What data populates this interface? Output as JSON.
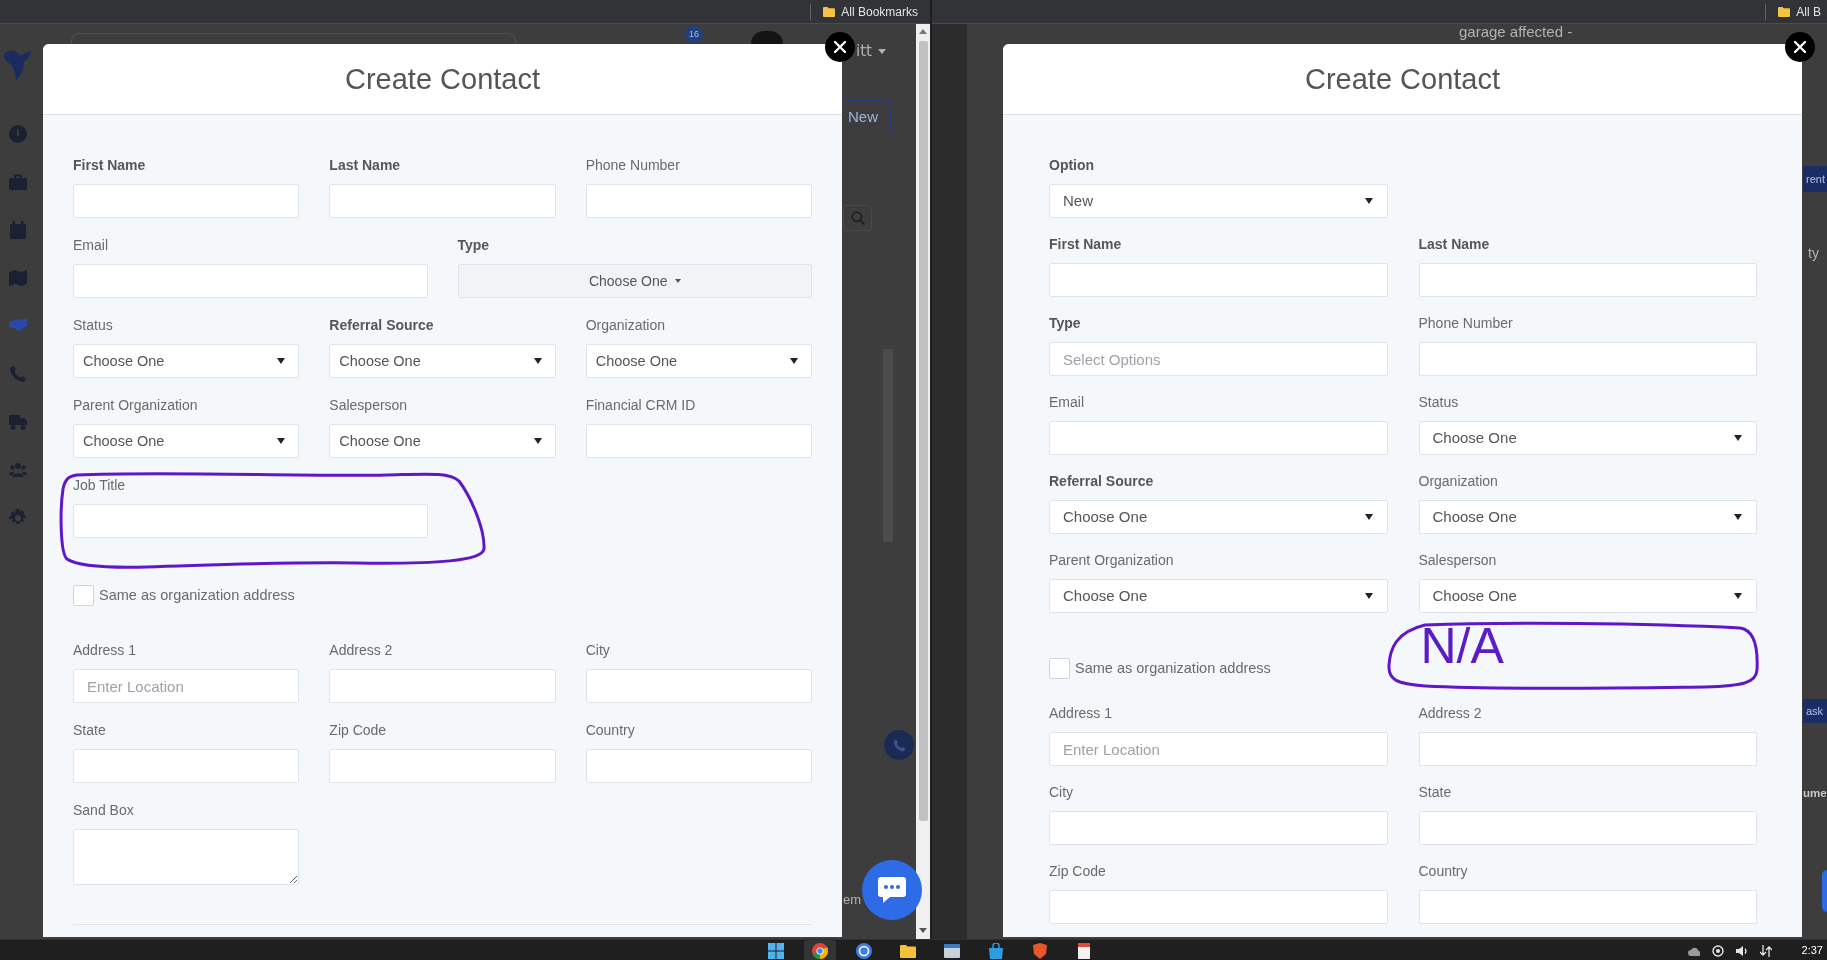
{
  "windows": [
    {
      "bookmarks_bar": {
        "label": "All Bookmarks"
      },
      "background_app": {
        "sidebar": {
          "items": [
            {
              "selected": false
            },
            {
              "selected": false
            },
            {
              "selected": false
            },
            {
              "selected": false
            },
            {
              "selected": true
            },
            {
              "selected": false
            },
            {
              "selected": false
            },
            {
              "selected": false
            },
            {
              "selected": false
            }
          ]
        },
        "notification_badge": "16",
        "user_menu": "itt",
        "new_button": "New",
        "fragments": [
          {
            "kind": "text",
            "text": "em"
          }
        ]
      },
      "modal": {
        "title": "Create Contact",
        "rows": [
          {
            "kind": "thirds",
            "circled": false,
            "fields": [
              {
                "label": "First Name",
                "bold": true,
                "kind": "text"
              },
              {
                "label": "Last Name",
                "bold": true,
                "kind": "text"
              },
              {
                "label": "Phone Number",
                "bold": false,
                "kind": "text"
              }
            ]
          },
          {
            "kind": "halves",
            "circled": false,
            "fields": [
              {
                "label": "Email",
                "bold": false,
                "kind": "text"
              },
              {
                "label": "Type",
                "bold": true,
                "kind": "dropdown",
                "value": "Choose One"
              }
            ]
          },
          {
            "kind": "thirds",
            "circled": false,
            "fields": [
              {
                "label": "Status",
                "bold": false,
                "kind": "select",
                "value": "Choose One"
              },
              {
                "label": "Referral Source",
                "bold": true,
                "kind": "select",
                "value": "Choose One"
              },
              {
                "label": "Organization",
                "bold": false,
                "kind": "select",
                "value": "Choose One"
              }
            ]
          },
          {
            "kind": "thirds",
            "circled": false,
            "fields": [
              {
                "label": "Parent Organization",
                "bold": false,
                "kind": "select",
                "value": "Choose One"
              },
              {
                "label": "Salesperson",
                "bold": false,
                "kind": "select",
                "value": "Choose One"
              },
              {
                "label": "Financial CRM ID",
                "bold": false,
                "kind": "text"
              }
            ]
          },
          {
            "kind": "halves",
            "circled": true,
            "fields": [
              {
                "label": "Job Title",
                "bold": false,
                "kind": "text"
              }
            ]
          },
          {
            "kind": "checkbox",
            "label": "Same as organization address",
            "checked": false
          },
          {
            "kind": "thirds",
            "circled": false,
            "fields": [
              {
                "label": "Address 1",
                "bold": false,
                "kind": "text",
                "placeholder": "Enter Location"
              },
              {
                "label": "Address 2",
                "bold": false,
                "kind": "text"
              },
              {
                "label": "City",
                "bold": false,
                "kind": "text"
              }
            ]
          },
          {
            "kind": "thirds",
            "circled": false,
            "fields": [
              {
                "label": "State",
                "bold": false,
                "kind": "text"
              },
              {
                "label": "Zip Code",
                "bold": false,
                "kind": "text"
              },
              {
                "label": "Country",
                "bold": false,
                "kind": "text"
              }
            ]
          },
          {
            "kind": "thirds",
            "circled": false,
            "fields": [
              {
                "label": "Sand Box",
                "bold": false,
                "kind": "textarea"
              }
            ]
          }
        ]
      }
    },
    {
      "bookmarks_bar": {
        "label": "All B"
      },
      "background_app": {
        "note": "garage affected -",
        "fragments": [
          {
            "kind": "button",
            "text": "rent"
          },
          {
            "kind": "text",
            "text": "ty"
          },
          {
            "kind": "button",
            "text": "ask"
          },
          {
            "kind": "heading",
            "text": "ume"
          }
        ]
      },
      "modal": {
        "title": "Create Contact",
        "rows": [
          {
            "kind": "halves",
            "circled": false,
            "fields": [
              {
                "label": "Option",
                "bold": true,
                "kind": "select",
                "value": "New"
              }
            ]
          },
          {
            "kind": "halves",
            "circled": false,
            "fields": [
              {
                "label": "First Name",
                "bold": true,
                "kind": "text"
              },
              {
                "label": "Last Name",
                "bold": true,
                "kind": "text"
              }
            ]
          },
          {
            "kind": "halves",
            "circled": false,
            "fields": [
              {
                "label": "Type",
                "bold": true,
                "kind": "text",
                "placeholder": "Select Options"
              },
              {
                "label": "Phone Number",
                "bold": false,
                "kind": "text"
              }
            ]
          },
          {
            "kind": "halves",
            "circled": false,
            "fields": [
              {
                "label": "Email",
                "bold": false,
                "kind": "text"
              },
              {
                "label": "Status",
                "bold": false,
                "kind": "select",
                "value": "Choose One"
              }
            ]
          },
          {
            "kind": "halves",
            "circled": false,
            "fields": [
              {
                "label": "Referral Source",
                "bold": true,
                "kind": "select",
                "value": "Choose One"
              },
              {
                "label": "Organization",
                "bold": false,
                "kind": "select",
                "value": "Choose One"
              }
            ]
          },
          {
            "kind": "halves",
            "circled": false,
            "fields": [
              {
                "label": "Parent Organization",
                "bold": false,
                "kind": "select",
                "value": "Choose One"
              },
              {
                "label": "Salesperson",
                "bold": false,
                "kind": "select",
                "value": "Choose One"
              }
            ]
          },
          {
            "kind": "checkbox",
            "label": "Same as organization address",
            "checked": false,
            "handwritten_note": "N/A"
          },
          {
            "kind": "halves",
            "circled": false,
            "fields": [
              {
                "label": "Address 1",
                "bold": false,
                "kind": "text",
                "placeholder": "Enter Location"
              },
              {
                "label": "Address 2",
                "bold": false,
                "kind": "text"
              }
            ]
          },
          {
            "kind": "halves",
            "circled": false,
            "fields": [
              {
                "label": "City",
                "bold": false,
                "kind": "text"
              },
              {
                "label": "State",
                "bold": false,
                "kind": "text"
              }
            ]
          },
          {
            "kind": "halves",
            "circled": false,
            "fields": [
              {
                "label": "Zip Code",
                "bold": false,
                "kind": "text"
              },
              {
                "label": "Country",
                "bold": false,
                "kind": "text"
              }
            ]
          }
        ]
      }
    }
  ],
  "taskbar": {
    "apps": [
      {
        "selected": false
      },
      {
        "selected": true
      },
      {
        "selected": false
      },
      {
        "selected": false
      },
      {
        "selected": false
      },
      {
        "selected": false
      },
      {
        "selected": false
      },
      {
        "selected": false
      }
    ],
    "clock": "2:37"
  }
}
